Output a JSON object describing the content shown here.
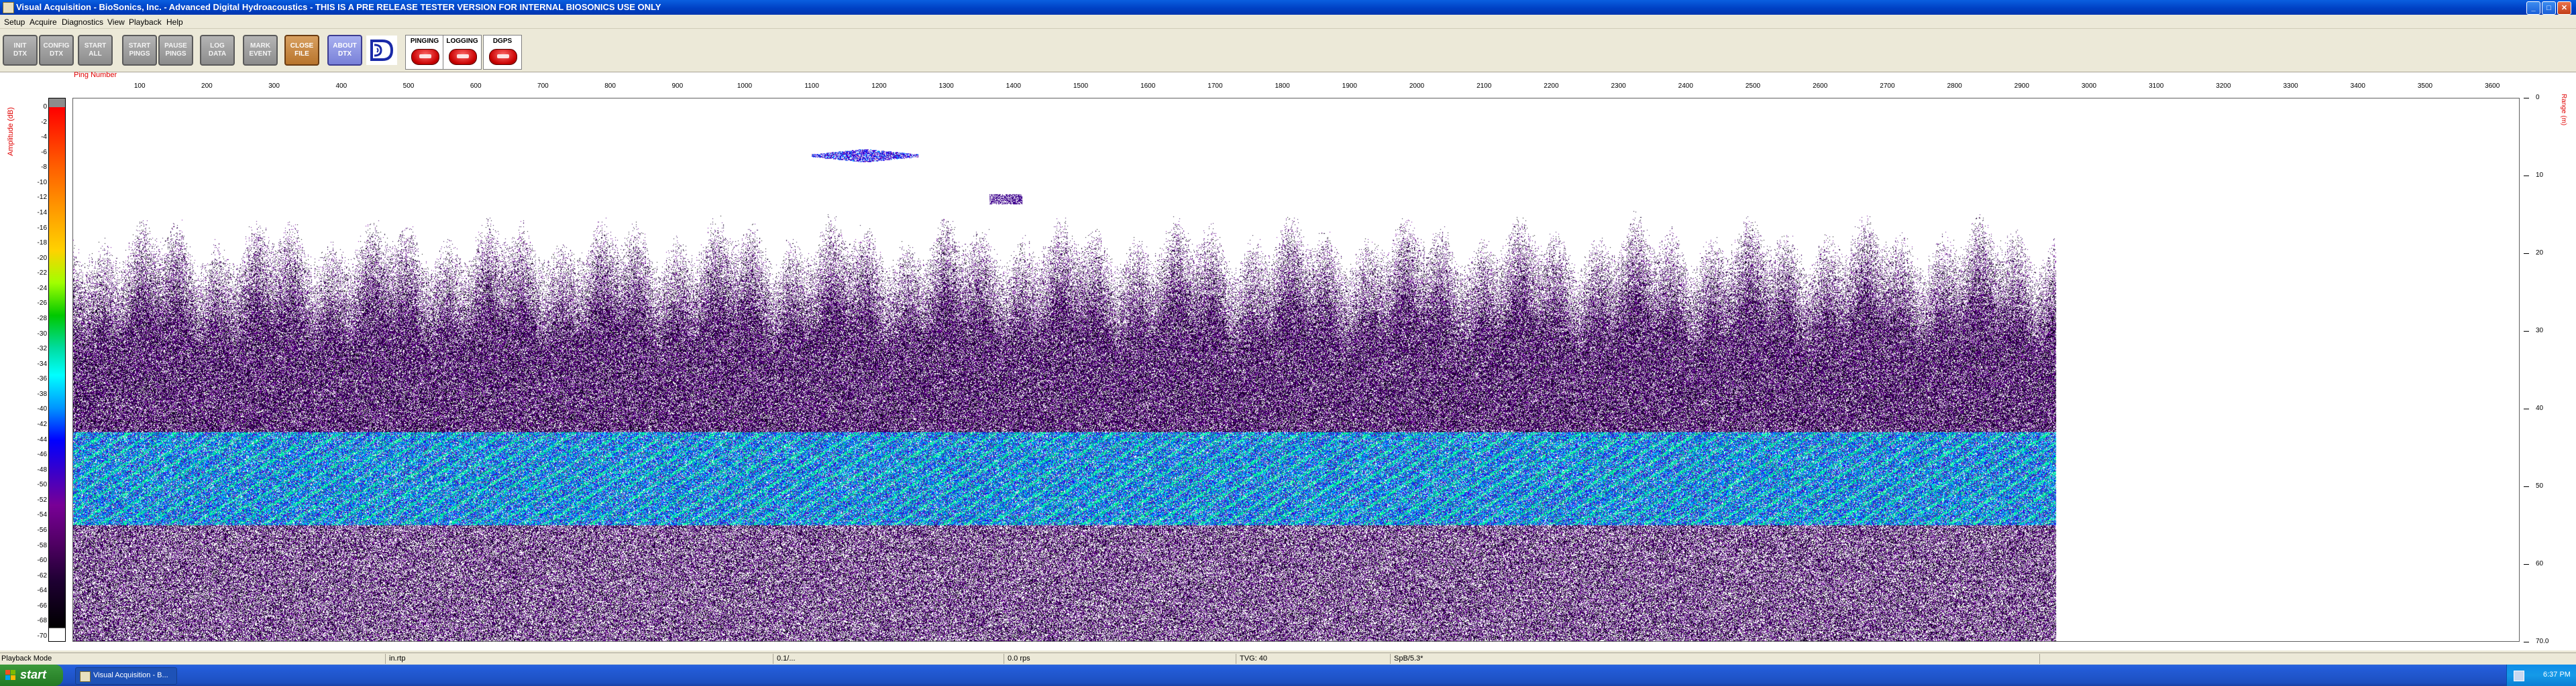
{
  "window": {
    "title": "Visual Acquisition  -  BioSonics, Inc.  -  Advanced Digital Hydroacoustics  -  THIS IS A PRE RELEASE TESTER VERSION FOR INTERNAL BIOSONICS USE ONLY",
    "minimize": "_",
    "maximize": "□",
    "close": "✕"
  },
  "menu": [
    "Setup",
    "Acquire",
    "Diagnostics",
    "View",
    "Playback",
    "Help"
  ],
  "toolbar": {
    "buttons": [
      {
        "label": "INIT\nDTX"
      },
      {
        "label": "CONFIG\nDTX"
      },
      {
        "label": "START\nALL"
      },
      {
        "label": "START\nPINGS"
      },
      {
        "label": "PAUSE\nPINGS"
      },
      {
        "label": "LOG\nDATA"
      },
      {
        "label": "MARK\nEVENT"
      },
      {
        "label": "CLOSE\nFILE"
      },
      {
        "label": "ABOUT\nDTX"
      }
    ],
    "indicators": [
      {
        "label": "PINGING",
        "state": "off"
      },
      {
        "label": "LOGGING",
        "state": "off"
      },
      {
        "label": "DGPS",
        "state": "off"
      }
    ]
  },
  "echogram": {
    "x_title": "Ping Number",
    "left_title": "Amplitude (dB)",
    "right_title": "Range (m)",
    "x_ticks": [
      "100",
      "200",
      "300",
      "400",
      "500",
      "600",
      "700",
      "800",
      "900",
      "1000",
      "1100",
      "1200",
      "1300",
      "1400",
      "1500",
      "1600",
      "1700",
      "1800",
      "1900",
      "2000",
      "2100",
      "2200",
      "2300",
      "2400",
      "2500",
      "2600",
      "2700",
      "2800",
      "2900",
      "3000",
      "3100",
      "3200",
      "3300",
      "3400",
      "3500",
      "3600"
    ],
    "amplitude_ticks": [
      "0",
      "-2",
      "-4",
      "-6",
      "-8",
      "-10",
      "-12",
      "-14",
      "-16",
      "-18",
      "-20",
      "-22",
      "-24",
      "-26",
      "-28",
      "-30",
      "-32",
      "-34",
      "-36",
      "-38",
      "-40",
      "-42",
      "-44",
      "-46",
      "-48",
      "-50",
      "-52",
      "-54",
      "-56",
      "-58",
      "-60",
      "-62",
      "-64",
      "-66",
      "-68",
      "-70"
    ],
    "range_ticks": [
      "0",
      "10",
      "20",
      "30",
      "40",
      "50",
      "60",
      "70.0"
    ],
    "data_end_ping": 2950,
    "band_range_m": [
      43,
      55
    ]
  },
  "statusbar": {
    "mode": "Playback Mode",
    "field2": "in.rtp",
    "field3": "0.1/...",
    "field4": "0.0 rps",
    "field5": "TVG: 40",
    "field6": "SpB/5.3*"
  },
  "taskbar": {
    "start": "start",
    "item": "Visual Acquisition - B...",
    "clock": "6:37 PM"
  }
}
